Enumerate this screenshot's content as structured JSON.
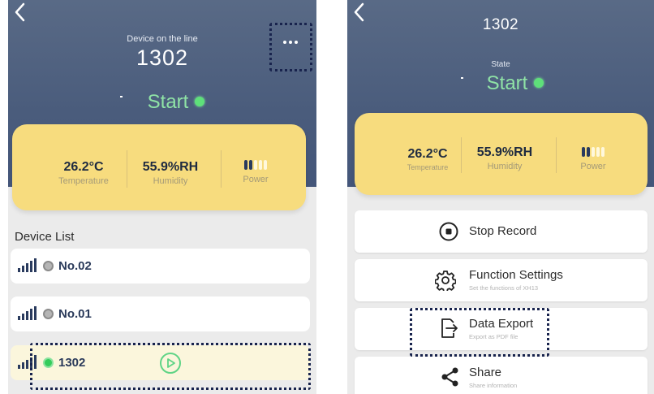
{
  "left_screen": {
    "header": {
      "subtitle": "Device on the line",
      "device_name": "1302",
      "state": "Start"
    },
    "readings": {
      "temperature_value": "26.2°C",
      "temperature_label": "Temperature",
      "humidity_value": "55.9%RH",
      "humidity_label": "Humidity",
      "power_label": "Power",
      "battery_level_segments": 2,
      "battery_total_segments": 5
    },
    "device_list": {
      "title": "Device List",
      "items": [
        {
          "label": "No.02",
          "online": false
        },
        {
          "label": "No.01",
          "online": false
        },
        {
          "label": "1302",
          "online": true
        }
      ]
    }
  },
  "right_screen": {
    "header": {
      "device_name": "1302",
      "state_label": "State",
      "state": "Start"
    },
    "readings": {
      "temperature_value": "26.2°C",
      "temperature_label": "Temperature",
      "humidity_value": "55.9%RH",
      "humidity_label": "Humidity",
      "power_label": "Power",
      "battery_level_segments": 2,
      "battery_total_segments": 5
    },
    "actions": [
      {
        "title": "Stop Record",
        "subtitle": "",
        "icon": "stop-circle-icon"
      },
      {
        "title": "Function Settings",
        "subtitle": "Set the functions of XH13",
        "icon": "gear-icon"
      },
      {
        "title": "Data Export",
        "subtitle": "Export as PDF file",
        "icon": "export-file-icon"
      },
      {
        "title": "Share",
        "subtitle": "Share information",
        "icon": "share-icon"
      }
    ]
  },
  "colors": {
    "header_blue": "#4a5c7c",
    "card_yellow": "#f7dc7e",
    "state_green": "#8fe3a6",
    "online_green": "#34cc5b",
    "highlight_navy": "#18234d"
  }
}
